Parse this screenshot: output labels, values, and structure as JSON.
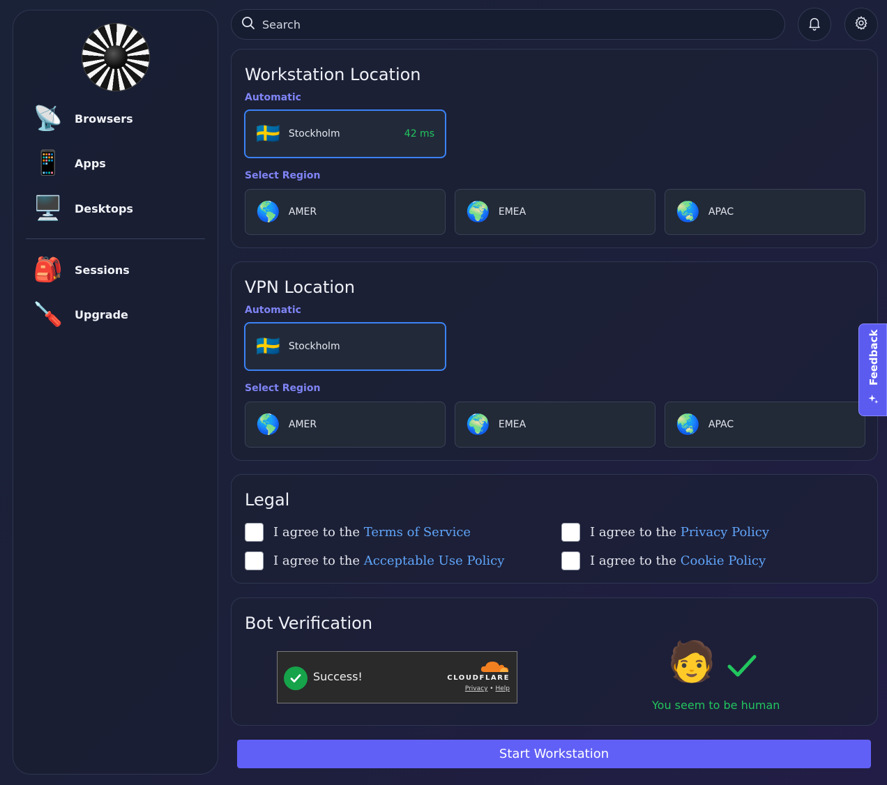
{
  "sidebar": {
    "items": [
      {
        "label": "Browsers",
        "icon": "satellite-dish-icon",
        "glyph": "📡"
      },
      {
        "label": "Apps",
        "icon": "mobile-phone-icon",
        "glyph": "📱"
      },
      {
        "label": "Desktops",
        "icon": "desktop-computer-icon",
        "glyph": "🖥️"
      },
      {
        "label": "Sessions",
        "icon": "backpack-icon",
        "glyph": "🎒"
      },
      {
        "label": "Upgrade",
        "icon": "screwdriver-icon",
        "glyph": "🪛"
      }
    ]
  },
  "search": {
    "placeholder": "Search"
  },
  "workstation": {
    "title": "Workstation Location",
    "automatic_label": "Automatic",
    "selected": {
      "label": "Stockholm",
      "flag": "🇸🇪",
      "latency": "42 ms"
    },
    "region_label": "Select Region",
    "regions": [
      {
        "label": "AMER",
        "glyph": "🌎"
      },
      {
        "label": "EMEA",
        "glyph": "🌍"
      },
      {
        "label": "APAC",
        "glyph": "🌏"
      }
    ]
  },
  "vpn": {
    "title": "VPN Location",
    "automatic_label": "Automatic",
    "selected": {
      "label": "Stockholm",
      "flag": "🇸🇪"
    },
    "region_label": "Select Region",
    "regions": [
      {
        "label": "AMER",
        "glyph": "🌎"
      },
      {
        "label": "EMEA",
        "glyph": "🌍"
      },
      {
        "label": "APAC",
        "glyph": "🌏"
      }
    ]
  },
  "legal": {
    "title": "Legal",
    "prefix": "I agree to the ",
    "items": [
      {
        "link": "Terms of Service"
      },
      {
        "link": "Privacy Policy"
      },
      {
        "link": "Acceptable Use Policy"
      },
      {
        "link": "Cookie Policy"
      }
    ]
  },
  "bot": {
    "title": "Bot Verification",
    "widget": {
      "status": "Success!",
      "brand": "CLOUDFLARE",
      "privacy": "Privacy",
      "separator": "•",
      "help": "Help"
    },
    "human_glyph": "🧑",
    "human_text": "You seem to be human"
  },
  "start_button": "Start Workstation",
  "feedback": "Feedback",
  "colors": {
    "accent": "#6160f6",
    "link": "#60a5fa",
    "success": "#22c55e",
    "selected_border": "#3b82f6"
  }
}
